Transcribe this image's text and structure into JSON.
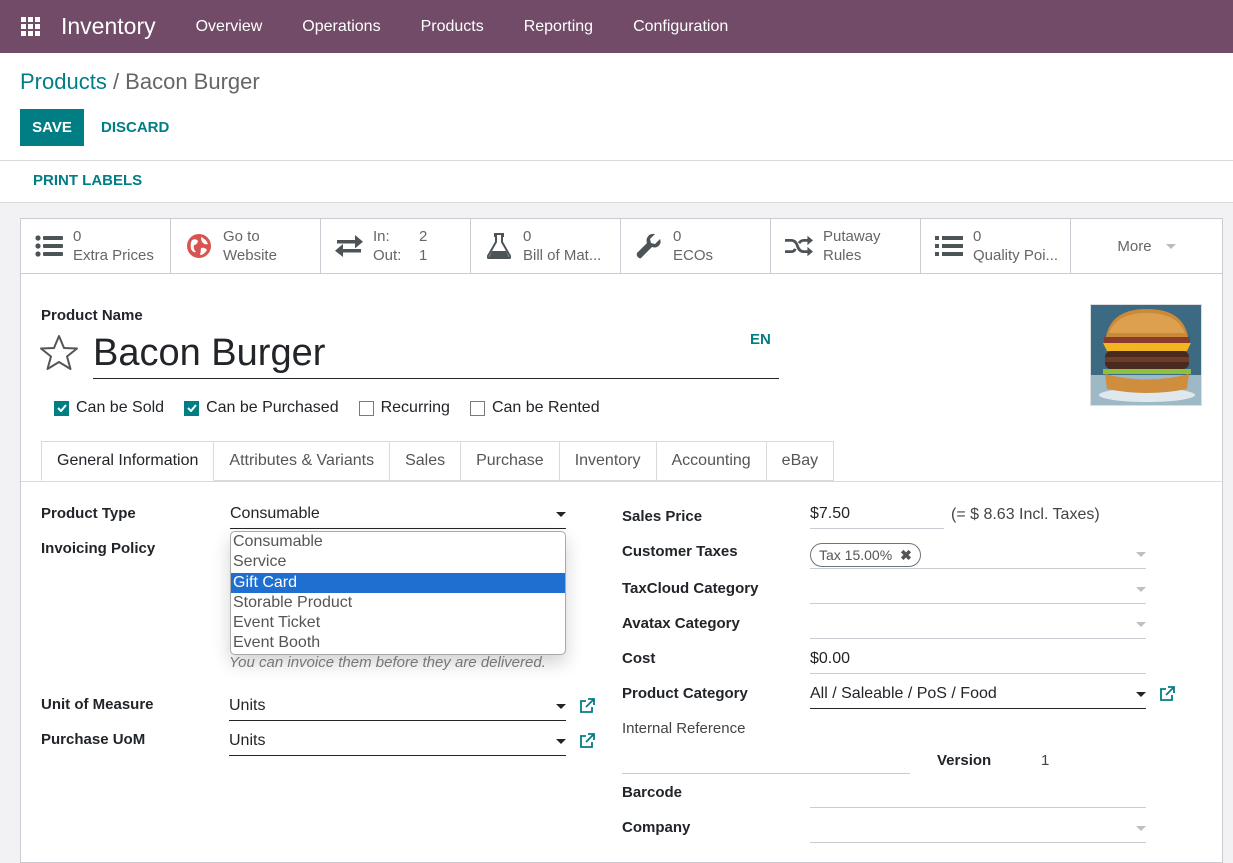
{
  "navbar": {
    "app_name": "Inventory",
    "menu": [
      "Overview",
      "Operations",
      "Products",
      "Reporting",
      "Configuration"
    ]
  },
  "breadcrumb": {
    "parent": "Products",
    "separator": " / ",
    "current": "Bacon Burger"
  },
  "actions": {
    "save": "SAVE",
    "discard": "DISCARD",
    "print_labels": "PRINT LABELS"
  },
  "stat_buttons": {
    "extra_prices": {
      "value": "0",
      "label": "Extra Prices",
      "icon": "list-icon"
    },
    "website": {
      "line1": "Go to",
      "line2": "Website",
      "icon": "globe-icon"
    },
    "in_out": {
      "in_label": "In:",
      "in_value": "2",
      "out_label": "Out:",
      "out_value": "1",
      "icon": "exchange-icon"
    },
    "bom": {
      "value": "0",
      "label": "Bill of Mat...",
      "icon": "flask-icon"
    },
    "ecos": {
      "value": "0",
      "label": "ECOs",
      "icon": "wrench-icon"
    },
    "putaway": {
      "line1": "Putaway",
      "line2": "Rules",
      "icon": "random-icon"
    },
    "quality": {
      "value": "0",
      "label": "Quality Poi...",
      "icon": "list-icon"
    },
    "more": "More"
  },
  "product": {
    "name_label": "Product Name",
    "name": "Bacon Burger",
    "lang": "EN",
    "image": "burger-photo"
  },
  "checkboxes": [
    {
      "label": "Can be Sold",
      "checked": true
    },
    {
      "label": "Can be Purchased",
      "checked": true
    },
    {
      "label": "Recurring",
      "checked": false
    },
    {
      "label": "Can be Rented",
      "checked": false
    }
  ],
  "tabs": [
    "General Information",
    "Attributes & Variants",
    "Sales",
    "Purchase",
    "Inventory",
    "Accounting",
    "eBay"
  ],
  "left_form": {
    "product_type_label": "Product Type",
    "product_type_value": "Consumable",
    "product_type_options": [
      "Consumable",
      "Service",
      "Gift Card",
      "Storable Product",
      "Event Ticket",
      "Event Booth"
    ],
    "product_type_highlighted": "Gift Card",
    "invoicing_policy_label": "Invoicing Policy",
    "invoicing_help": "You can invoice them before they are delivered.",
    "uom_label": "Unit of Measure",
    "uom_value": "Units",
    "purchase_uom_label": "Purchase UoM",
    "purchase_uom_value": "Units"
  },
  "right_form": {
    "sales_price_label": "Sales Price",
    "sales_price_value": "$7.50",
    "incl_taxes": "(= $ 8.63 Incl. Taxes)",
    "customer_taxes_label": "Customer Taxes",
    "customer_tax_tag": "Tax 15.00%",
    "taxcloud_label": "TaxCloud Category",
    "avatax_label": "Avatax Category",
    "cost_label": "Cost",
    "cost_value": "$0.00",
    "category_label": "Product Category",
    "category_value": "All / Saleable / PoS / Food",
    "internal_ref_label": "Internal Reference",
    "version_label": "Version",
    "version_value": "1",
    "barcode_label": "Barcode",
    "company_label": "Company"
  },
  "colors": {
    "navbar": "#714b67",
    "primary": "#017e84",
    "highlight": "#1f6fd1"
  }
}
